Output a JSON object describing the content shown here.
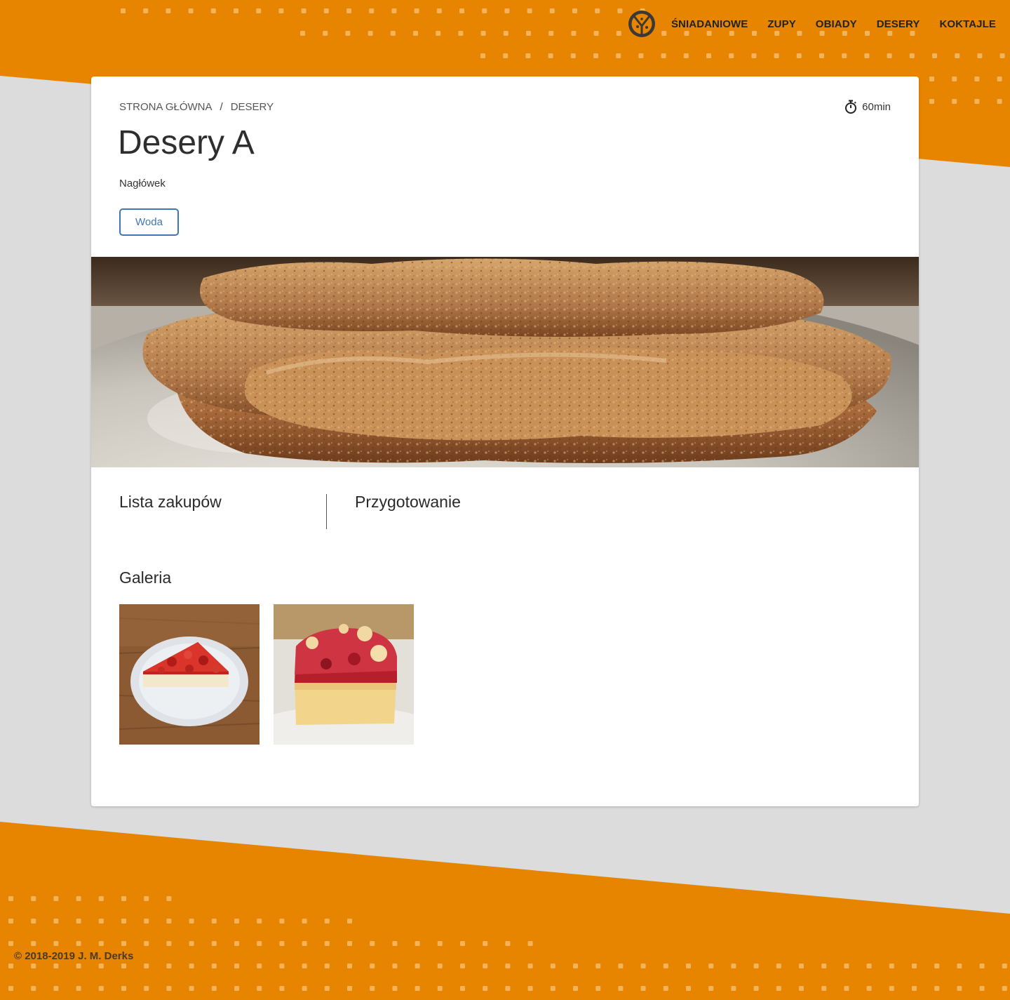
{
  "nav": {
    "logo_icon": "pizza-logo-icon",
    "items": [
      "ŚNIADANIOWE",
      "ZUPY",
      "OBIADY",
      "DESERY",
      "KOKTAJLE"
    ]
  },
  "breadcrumb": {
    "home": "STRONA GŁÓWNA",
    "separator": "/",
    "current": "DESERY"
  },
  "recipe": {
    "time_icon": "stopwatch-icon",
    "time": "60min",
    "title": "Desery A",
    "subheader": "Nagłówek",
    "tag": "Woda",
    "hero_image": "fried-schnitzel-photo"
  },
  "sections": {
    "shopping": "Lista zakupów",
    "preparation": "Przygotowanie",
    "gallery": "Galeria"
  },
  "gallery": {
    "images": [
      "strawberry-tart-slice-photo",
      "strawberry-crumble-cake-photo"
    ]
  },
  "footer": {
    "copyright": "© 2018-2019 J. M. Derks"
  },
  "colors": {
    "accent_orange": "#e88500",
    "background_gray": "#dcdcdc",
    "card": "#ffffff",
    "tag_blue": "#3f76b5"
  }
}
